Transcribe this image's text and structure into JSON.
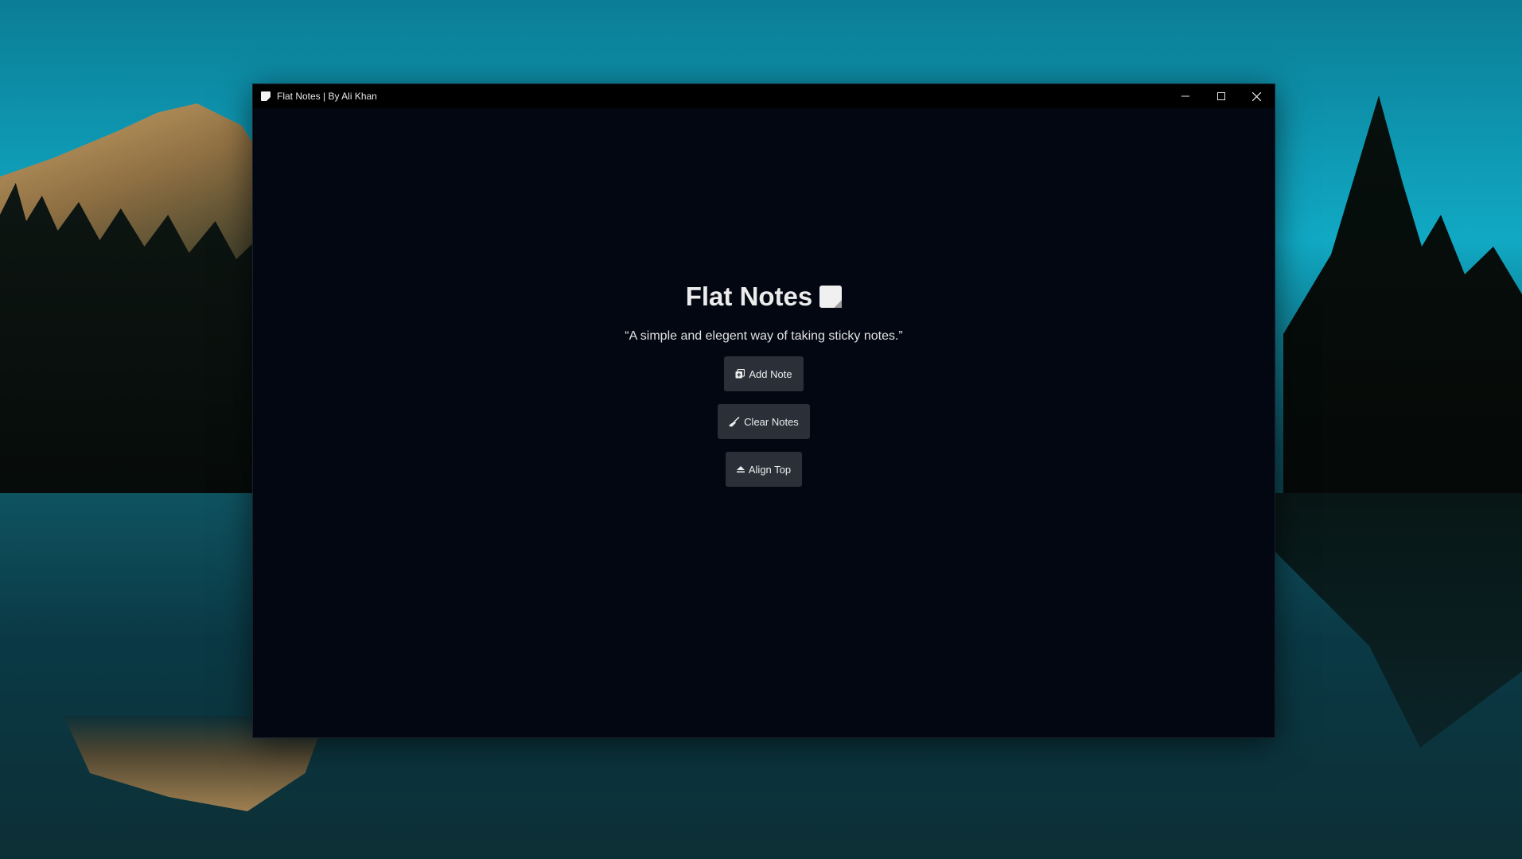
{
  "window": {
    "title": "Flat Notes | By Ali Khan",
    "controls": [
      "minimize-icon",
      "maximize-icon",
      "close-icon"
    ]
  },
  "main": {
    "heading": "Flat Notes",
    "heading_icon": "sticky-note-icon",
    "tagline": "“A simple and elegent way of taking sticky notes.”",
    "buttons": [
      {
        "label": "Add Note",
        "icon": "add-note-icon"
      },
      {
        "label": "Clear Notes",
        "icon": "broom-icon"
      },
      {
        "label": "Align Top",
        "icon": "eject-up-icon"
      }
    ]
  },
  "colors": {
    "window_bg": "#030712",
    "titlebar_bg": "#000000",
    "button_bg": "#2a2f38",
    "text": "#ececec"
  }
}
